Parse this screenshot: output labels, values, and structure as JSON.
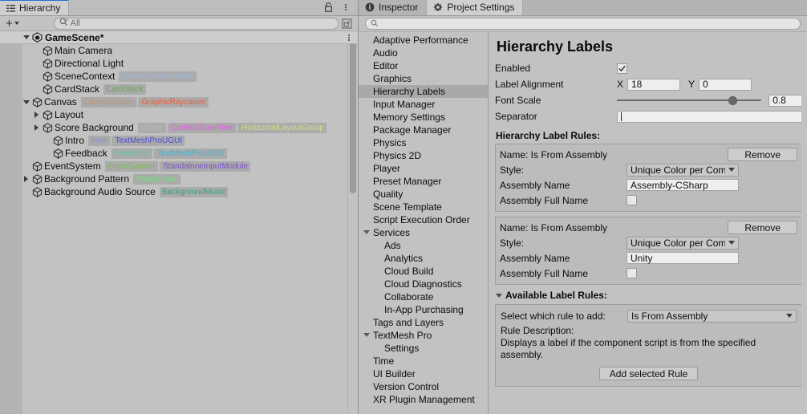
{
  "hierarchy": {
    "tab": {
      "label": "Hierarchy",
      "icon": "hierarchy-icon"
    },
    "lock_icon": "lock-icon",
    "menu_icon": "kebab-menu-icon",
    "toolbar": {
      "create_label": "+",
      "search_placeholder": "All",
      "search_value": "",
      "search_icon": "search-icon",
      "sort_icon": "sort-icon"
    },
    "scene": {
      "name": "GameScene*",
      "icon": "unity-scene-icon",
      "expanded": true
    },
    "rows": [
      {
        "name": "Main Camera",
        "indent": 2,
        "twisty": "none",
        "labels": []
      },
      {
        "name": "Directional Light",
        "indent": 2,
        "twisty": "none",
        "labels": []
      },
      {
        "name": "SceneContext",
        "indent": 2,
        "twisty": "none",
        "labels": [
          {
            "text": "GameSceneInstaller",
            "color": "#9fb6dd"
          }
        ]
      },
      {
        "name": "CardStack",
        "indent": 2,
        "twisty": "none",
        "labels": [
          {
            "text": "CardStack",
            "color": "#6da35a"
          }
        ]
      },
      {
        "name": "Canvas",
        "indent": 1,
        "twisty": "open",
        "labels": [
          {
            "text": "CanvasScaler",
            "color": "#b99478"
          },
          {
            "text": "GraphicRaycaster",
            "color": "#f05a38"
          }
        ]
      },
      {
        "name": "Layout",
        "indent": 2,
        "twisty": "closed",
        "labels": []
      },
      {
        "name": "Score Background",
        "indent": 2,
        "twisty": "closed",
        "labels": [
          {
            "text": "Image",
            "color": "#b5b5b5"
          },
          {
            "text": "ContentSizeFitter",
            "color": "#e05fe0"
          },
          {
            "text": "HorizontalLayoutGroup",
            "color": "#d9d98c"
          }
        ]
      },
      {
        "name": "Intro",
        "indent": 3,
        "twisty": "none",
        "labels": [
          {
            "text": "Intro",
            "color": "#8a8fc4"
          },
          {
            "text": "TextMeshProUGUI",
            "color": "#4a4ad8"
          }
        ]
      },
      {
        "name": "Feedback",
        "indent": 3,
        "twisty": "none",
        "labels": [
          {
            "text": "Feedback",
            "color": "#66c4a0"
          },
          {
            "text": "TextMeshProUGUI",
            "color": "#43b0d1"
          }
        ]
      },
      {
        "name": "EventSystem",
        "indent": 1,
        "twisty": "none",
        "labels": [
          {
            "text": "EventSystem",
            "color": "#7dbb5a"
          },
          {
            "text": "StandaloneInputModule",
            "color": "#7a4fcf"
          }
        ]
      },
      {
        "name": "Background Pattern",
        "indent": 1,
        "twisty": "closed",
        "labels": [
          {
            "text": "Background",
            "color": "#7ed97e"
          }
        ]
      },
      {
        "name": "Background Audio Source",
        "indent": 1,
        "twisty": "none",
        "labels": [
          {
            "text": "BackgroundMusic",
            "color": "#3f9e72"
          }
        ]
      }
    ]
  },
  "settings": {
    "tabs": [
      {
        "label": "Inspector",
        "icon": "info-icon",
        "active": false
      },
      {
        "label": "Project Settings",
        "icon": "gear-icon",
        "active": true
      }
    ],
    "search": {
      "value": "",
      "placeholder": "",
      "icon": "search-icon"
    },
    "categories": [
      {
        "label": "Adaptive Performance",
        "selected": false,
        "child": false,
        "foldout": "none"
      },
      {
        "label": "Audio",
        "selected": false,
        "child": false,
        "foldout": "none"
      },
      {
        "label": "Editor",
        "selected": false,
        "child": false,
        "foldout": "none"
      },
      {
        "label": "Graphics",
        "selected": false,
        "child": false,
        "foldout": "none"
      },
      {
        "label": "Hierarchy Labels",
        "selected": true,
        "child": false,
        "foldout": "none"
      },
      {
        "label": "Input Manager",
        "selected": false,
        "child": false,
        "foldout": "none"
      },
      {
        "label": "Memory Settings",
        "selected": false,
        "child": false,
        "foldout": "none"
      },
      {
        "label": "Package Manager",
        "selected": false,
        "child": false,
        "foldout": "none"
      },
      {
        "label": "Physics",
        "selected": false,
        "child": false,
        "foldout": "none"
      },
      {
        "label": "Physics 2D",
        "selected": false,
        "child": false,
        "foldout": "none"
      },
      {
        "label": "Player",
        "selected": false,
        "child": false,
        "foldout": "none"
      },
      {
        "label": "Preset Manager",
        "selected": false,
        "child": false,
        "foldout": "none"
      },
      {
        "label": "Quality",
        "selected": false,
        "child": false,
        "foldout": "none"
      },
      {
        "label": "Scene Template",
        "selected": false,
        "child": false,
        "foldout": "none"
      },
      {
        "label": "Script Execution Order",
        "selected": false,
        "child": false,
        "foldout": "none"
      },
      {
        "label": "Services",
        "selected": false,
        "child": false,
        "foldout": "open"
      },
      {
        "label": "Ads",
        "selected": false,
        "child": true,
        "foldout": "none"
      },
      {
        "label": "Analytics",
        "selected": false,
        "child": true,
        "foldout": "none"
      },
      {
        "label": "Cloud Build",
        "selected": false,
        "child": true,
        "foldout": "none"
      },
      {
        "label": "Cloud Diagnostics",
        "selected": false,
        "child": true,
        "foldout": "none"
      },
      {
        "label": "Collaborate",
        "selected": false,
        "child": true,
        "foldout": "none"
      },
      {
        "label": "In-App Purchasing",
        "selected": false,
        "child": true,
        "foldout": "none"
      },
      {
        "label": "Tags and Layers",
        "selected": false,
        "child": false,
        "foldout": "none"
      },
      {
        "label": "TextMesh Pro",
        "selected": false,
        "child": false,
        "foldout": "open"
      },
      {
        "label": "Settings",
        "selected": false,
        "child": true,
        "foldout": "none"
      },
      {
        "label": "Time",
        "selected": false,
        "child": false,
        "foldout": "none"
      },
      {
        "label": "UI Builder",
        "selected": false,
        "child": false,
        "foldout": "none"
      },
      {
        "label": "Version Control",
        "selected": false,
        "child": false,
        "foldout": "none"
      },
      {
        "label": "XR Plugin Management",
        "selected": false,
        "child": false,
        "foldout": "none"
      }
    ],
    "page": {
      "title": "Hierarchy Labels",
      "enabled": {
        "label": "Enabled",
        "checked": true
      },
      "label_alignment": {
        "label": "Label Alignment",
        "x_axis": "X",
        "x_value": "18",
        "y_axis": "Y",
        "y_value": "0"
      },
      "font_scale": {
        "label": "Font Scale",
        "value": "0.8",
        "min": 0,
        "max": 1,
        "fill": 0.8
      },
      "separator": {
        "label": "Separator",
        "value": ""
      },
      "rules_header": "Hierarchy Label Rules:",
      "rules": [
        {
          "name_label": "Name: Is From Assembly",
          "remove_label": "Remove",
          "style_label": "Style:",
          "style_value": "Unique Color per Com",
          "assembly_name_label": "Assembly Name",
          "assembly_name_value": "Assembly-CSharp",
          "assembly_full_name_label": "Assembly Full Name",
          "assembly_full_name_checked": false
        },
        {
          "name_label": "Name: Is From Assembly",
          "remove_label": "Remove",
          "style_label": "Style:",
          "style_value": "Unique Color per Com",
          "assembly_name_label": "Assembly Name",
          "assembly_name_value": "Unity",
          "assembly_full_name_label": "Assembly Full Name",
          "assembly_full_name_checked": false
        }
      ],
      "available": {
        "foldout_label": "Available Label Rules:",
        "select_label": "Select which rule to add:",
        "select_value": "Is From Assembly",
        "description_label": "Rule Description:",
        "description_text": "Displays a label if the component script is from the specified assembly.",
        "add_button": "Add selected Rule"
      }
    }
  }
}
